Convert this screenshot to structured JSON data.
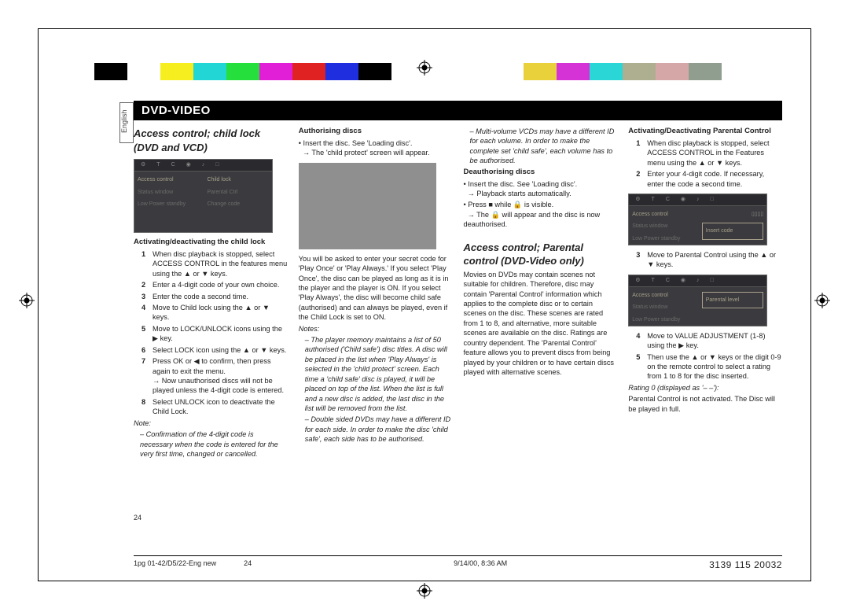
{
  "title_band": "DVD-VIDEO",
  "side_tab": "English",
  "col1": {
    "section_title": "Access control; child lock (DVD and VCD)",
    "menu": {
      "left1": "Access control",
      "left2": "Status window",
      "left3": "Low Power standby",
      "right1": "Child lock",
      "right2": "Parental Ctrl",
      "right3": "Change code"
    },
    "subhead1": "Activating/deactivating the child lock",
    "steps": {
      "s1": "When disc playback is stopped, select ACCESS CONTROL in the features menu using the ▲ or ▼ keys.",
      "s2": "Enter a 4-digit code of your own choice.",
      "s3": "Enter the code a second time.",
      "s4": "Move to Child lock using the ▲ or ▼ keys.",
      "s5": "Move to LOCK/UNLOCK icons using the ▶ key.",
      "s6": "Select LOCK icon using the ▲ or ▼ keys.",
      "s7a": "Press OK or ◀ to confirm, then press again to exit the menu.",
      "s7b": "→ Now unauthorised discs will not be played unless the 4-digit code is entered.",
      "s8": "Select UNLOCK icon to deactivate the Child Lock."
    },
    "note_label": "Note:",
    "note": "Confirmation of the 4-digit code is necessary when the code is entered for the very first time, changed or cancelled."
  },
  "col2": {
    "subhead1": "Authorising discs",
    "b1": "Insert the disc. See 'Loading disc'.",
    "b1a": "→ The 'child protect' screen will appear.",
    "para": "You will be asked to enter your secret code for 'Play Once' or 'Play Always.' If you select 'Play Once', the disc can be played as long as it is in the player and the player is ON. If you select 'Play Always', the disc will become child safe (authorised) and can always be played, even if the Child Lock is set to ON.",
    "notes_label": "Notes:",
    "note1": "The player memory maintains a list of 50 authorised ('Child safe') disc titles. A disc will be placed in the list when 'Play Always' is selected in the 'child protect' screen. Each time a 'child safe' disc is played, it will be placed on top of the list. When the list is full and a new disc is added, the last disc in the list will be removed from the list.",
    "note2": "Double sided DVDs may have a different ID for each side. In order to make the disc 'child safe', each side has to be authorised."
  },
  "col3": {
    "note1": "Multi-volume VCDs may have a different ID for each volume. In order to make the complete set 'child safe', each volume has to be authorised.",
    "subhead1": "Deauthorising discs",
    "b1": "Insert the disc. See 'Loading disc'.",
    "b1a": "→ Playback starts automatically.",
    "b2": "Press ■ while 🔒 is visible.",
    "b2a": "→ The 🔒 will appear and the disc is now deauthorised.",
    "section_title": "Access control; Parental control (DVD-Video only)",
    "para": "Movies on DVDs may contain scenes not suitable for children. Therefore, disc may contain 'Parental Control' information which applies to the complete disc or to certain scenes on the disc. These scenes are rated from 1 to 8, and alternative, more suitable scenes are available on the disc. Ratings are country dependent. The 'Parental Control' feature allows you to prevent discs from being played by your children or to have certain discs played with alternative scenes."
  },
  "col4": {
    "subhead1": "Activating/Deactivating Parental Control",
    "s1": "When disc playback is stopped, select ACCESS CONTROL in the Features menu using the ▲ or ▼ keys.",
    "s2": "Enter your 4-digit code. If necessary, enter the code a second time.",
    "menuA": {
      "left1": "Access control",
      "left2": "Status window",
      "left3": "Low Power standby",
      "right_box": "Insert code"
    },
    "s3": "Move to Parental Control using the ▲ or ▼ keys.",
    "menuB": {
      "left1": "Access control",
      "left2": "Status window",
      "left3": "Low Power standby",
      "right_box": "Parental level"
    },
    "s4": "Move to VALUE ADJUSTMENT (1-8) using the ▶ key.",
    "s5": "Then use the ▲ or ▼ keys or the digit 0-9 on the remote control to select a rating from 1 to 8 for the disc inserted.",
    "rating0_label": "Rating 0 (displayed as '– –'):",
    "rating0": "Parental Control is not activated. The Disc will be played in full."
  },
  "footer": {
    "left": "1pg 01-42/D5/22-Eng new",
    "pagenum": "24",
    "center": "9/14/00, 8:36 AM",
    "right": "3139 115 20032"
  },
  "colorbar": [
    "#000",
    "#fff",
    "#f7ee1f",
    "#22d6d6",
    "#25e03c",
    "#e11fd6",
    "#e02222",
    "#1f2fe0",
    "#000",
    "#fff",
    "#fff",
    "#fff",
    "#fff",
    "#e8d13a",
    "#d633d6",
    "#2bd6d6",
    "#aeae90",
    "#d6a7a7",
    "#8f9e8f",
    "#fff"
  ],
  "page_num_side": "24"
}
